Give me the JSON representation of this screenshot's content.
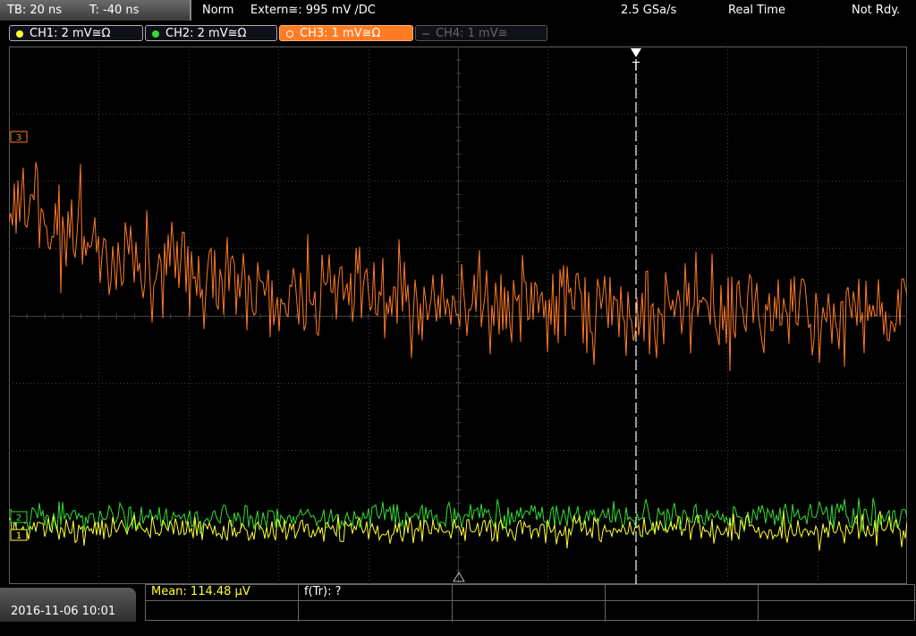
{
  "topbar": {
    "timebase": "TB: 20 ns",
    "trigger_time": "T: -40 ns",
    "trigger_mode": "Norm",
    "trigger_source": "Extern≅: 995 mV ∕DC",
    "sample_rate": "2.5 GSa/s",
    "acq_mode": "Real Time",
    "trigger_state": "Not Rdy."
  },
  "channels": [
    {
      "label": "CH1: 2 mV≅Ω",
      "color": "#ffff33",
      "active": true
    },
    {
      "label": "CH2: 2 mV≅Ω",
      "color": "#33dd33",
      "active": true
    },
    {
      "label": "CH3: 1 mV≅Ω",
      "color": "#ff7b24",
      "active": true
    },
    {
      "label": "CH4: 1 mV≅",
      "color": "#666666",
      "active": false
    }
  ],
  "screen": {
    "trigger_marker": "T",
    "ch3_marker": "3",
    "ch1_marker": "1",
    "ch2_marker": "2"
  },
  "bottom": {
    "datetime": "2016-11-06 10:01",
    "mean_label": "Mean: 114.48 µV",
    "freq_label": "f(Tr): ?"
  },
  "colors": {
    "grid": "#404040",
    "ch1": "#ffff33",
    "ch2": "#33dd33",
    "ch3": "#ff7b24",
    "meas_text": "#ffff33"
  }
}
